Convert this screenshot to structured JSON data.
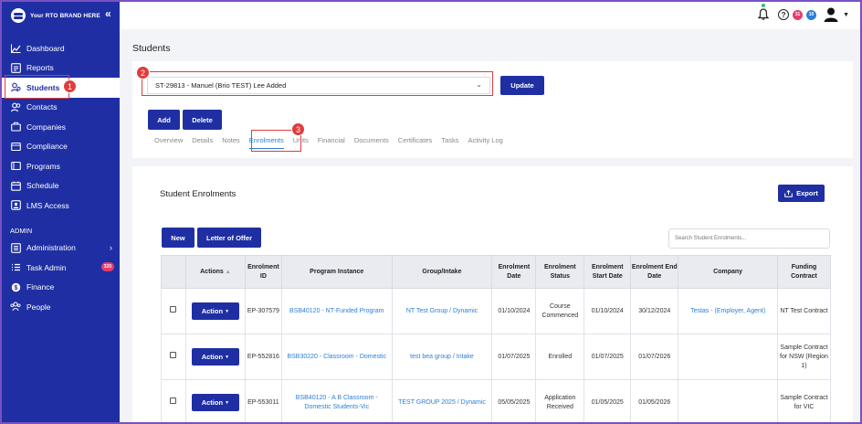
{
  "brand": {
    "name": "Your RTO BRAND HERE"
  },
  "sidebar": {
    "items": [
      {
        "label": "Dashboard",
        "icon": "chart-icon"
      },
      {
        "label": "Reports",
        "icon": "report-icon"
      },
      {
        "label": "Students",
        "icon": "students-icon"
      },
      {
        "label": "Contacts",
        "icon": "contacts-icon"
      },
      {
        "label": "Companies",
        "icon": "companies-icon"
      },
      {
        "label": "Compliance",
        "icon": "compliance-icon"
      },
      {
        "label": "Programs",
        "icon": "programs-icon"
      },
      {
        "label": "Schedule",
        "icon": "schedule-icon"
      },
      {
        "label": "LMS Access",
        "icon": "lms-icon"
      }
    ],
    "admin_title": "ADMIN",
    "admin_items": [
      {
        "label": "Administration",
        "icon": "gear-icon"
      },
      {
        "label": "Task Admin",
        "icon": "tasks-icon",
        "badge": "320"
      },
      {
        "label": "Finance",
        "icon": "finance-icon"
      },
      {
        "label": "People",
        "icon": "people-icon"
      }
    ]
  },
  "topbar": {
    "badge_red": "31",
    "badge_blue": "10"
  },
  "page": {
    "title": "Students"
  },
  "student_select": {
    "value": "ST-29813 - Manuel (Brio TEST) Lee Added"
  },
  "buttons": {
    "update": "Update",
    "add": "Add",
    "delete": "Delete"
  },
  "callouts": {
    "one": "1",
    "two": "2",
    "three": "3"
  },
  "tabs": [
    "Overview",
    "Details",
    "Notes",
    "Enrolments",
    "Units",
    "Financial",
    "Documents",
    "Certificates",
    "Tasks",
    "Activity Log"
  ],
  "enrolments": {
    "heading": "Student Enrolments",
    "export": "Export",
    "new": "New",
    "letter_of_offer": "Letter of Offer",
    "search_placeholder": "Search Student Enrolments...",
    "columns": [
      "Actions",
      "Enrolment ID",
      "Program Instance",
      "Group/Intake",
      "Enrolment Date",
      "Enrolment Status",
      "Enrolment Start Date",
      "Enrolment End Date",
      "Company",
      "Funding Contract"
    ],
    "rows": [
      {
        "action": "Action",
        "id": "EP-307579",
        "program": "BSB40120 - NT-Funded Program",
        "group": "NT Test Group / Dynamic",
        "date": "01/10/2024",
        "status": "Course Commenced",
        "start": "01/10/2024",
        "end": "30/12/2024",
        "company": "Testas - (Employer, Agent)",
        "contract": "NT Test Contract"
      },
      {
        "action": "Action",
        "id": "EP-552816",
        "program": "BSB30220 - Classroom - Domestic",
        "group": "test bea group / Intake",
        "date": "01/07/2025",
        "status": "Enrolled",
        "start": "01/07/2025",
        "end": "01/07/2026",
        "company": "",
        "contract": "Sample Contract for NSW (Region 1)"
      },
      {
        "action": "Action",
        "id": "EP-553011",
        "program": "BSB40120 - A B Classroom - Domestic Students-Vic",
        "group": "TEST GROUP 2025 / Dynamic",
        "date": "05/05/2025",
        "status": "Application Received",
        "start": "01/05/2025",
        "end": "01/05/2026",
        "company": "",
        "contract": "Sample Contract for VIC"
      }
    ]
  }
}
